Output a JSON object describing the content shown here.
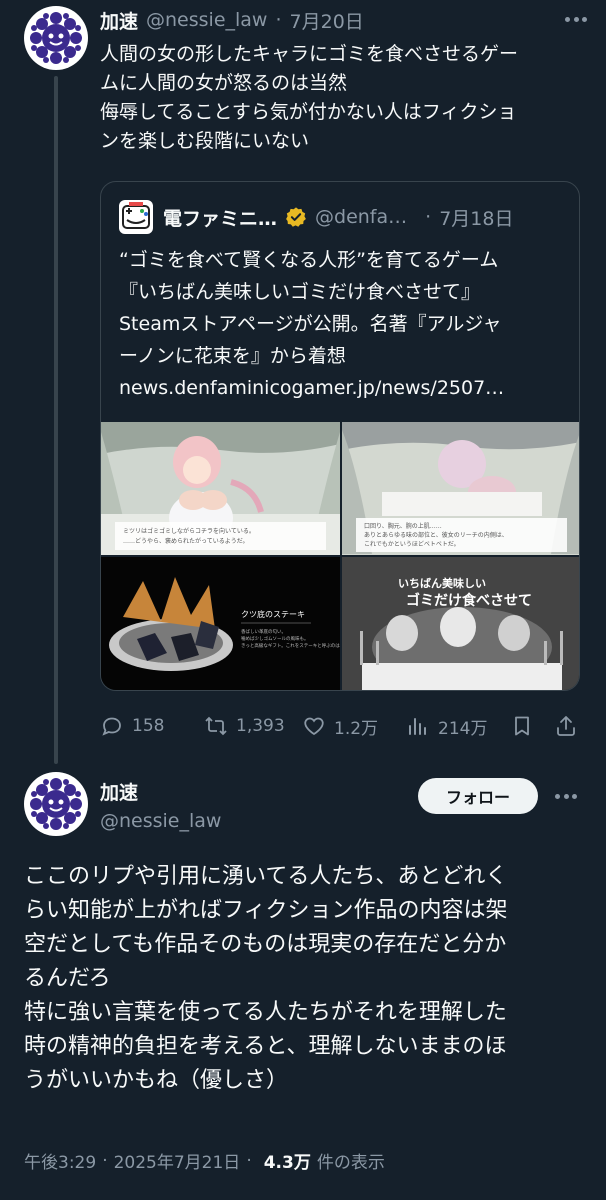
{
  "tweet1": {
    "display_name": "加速",
    "handle": "@nessie_law",
    "dot": "·",
    "date": "7月20日",
    "lines": [
      "人間の女の形したキャラにゴミを食べさせるゲー",
      "ムに人間の女が怒るのは当然",
      "侮辱してることすら気が付かない人はフィクショ",
      "ンを楽しむ段階にいない"
    ]
  },
  "quote": {
    "display_name": "電ファミニ…",
    "handle": "@denfa…",
    "dot": "·",
    "date": "7月18日",
    "lines": [
      "“ゴミを食べて賢くなる人形”を育てるゲーム",
      "『いちばん美味しいゴミだけ食べさせて』",
      "Steamストアページが公開。名著『アルジャ",
      "ーノンに花束を』から着想",
      "news.denfaminicogamer.jp/news/2507…"
    ],
    "images": [
      {
        "caption": "ミツリはゴミゴミしながらコチラを向いている。\n……どうやら、褒められたがっているようだ。"
      },
      {
        "caption": "口回り、胸元、腕の上肌……\nありとあらゆる味の部位と、彼女のリーチの内側は、\nこれでもかというほどベトベトだ。"
      },
      {
        "title": "クツ底のステーキ",
        "caption": "香ばしい革底の匂い。\n噛めば少しゴムソールの風味も。\nきっと高級なギフト。これをステーキと呼ぶのは"
      },
      {
        "title_line1": "いちばん美味しい",
        "title_line2": "ゴミだけ食べさせて"
      }
    ]
  },
  "actions": {
    "replies": "158",
    "reposts": "1,393",
    "likes": "1.2万",
    "views": "214万"
  },
  "tweet2": {
    "display_name": "加速",
    "handle": "@nessie_law",
    "follow_label": "フォロー",
    "lines": [
      "ここのリプや引用に湧いてる人たち、あとどれく",
      "らい知能が上がればフィクション作品の内容は架",
      "空だとしても作品そのものは現実の存在だと分か",
      "るんだろ",
      "特に強い言葉を使ってる人たちがそれを理解した",
      "時の精神的負担を考えると、理解しないままのほ",
      "うがいいかもね（優しさ）"
    ],
    "time": "午後3:29",
    "dot": "·",
    "date": "2025年7月21日",
    "dot2": "·",
    "views": "4.3万",
    "views_label": "件の表示"
  },
  "colors": {
    "background": "#15202b",
    "text": "#f7f9f9",
    "secondary": "#8b98a5",
    "border": "#38444d",
    "verified_gold": "#e8b923",
    "avatar_purple": "#3b2a8e"
  },
  "icons": [
    "more-icon",
    "verified-badge-icon",
    "reply-icon",
    "repost-icon",
    "like-icon",
    "views-icon",
    "bookmark-icon",
    "share-icon"
  ]
}
